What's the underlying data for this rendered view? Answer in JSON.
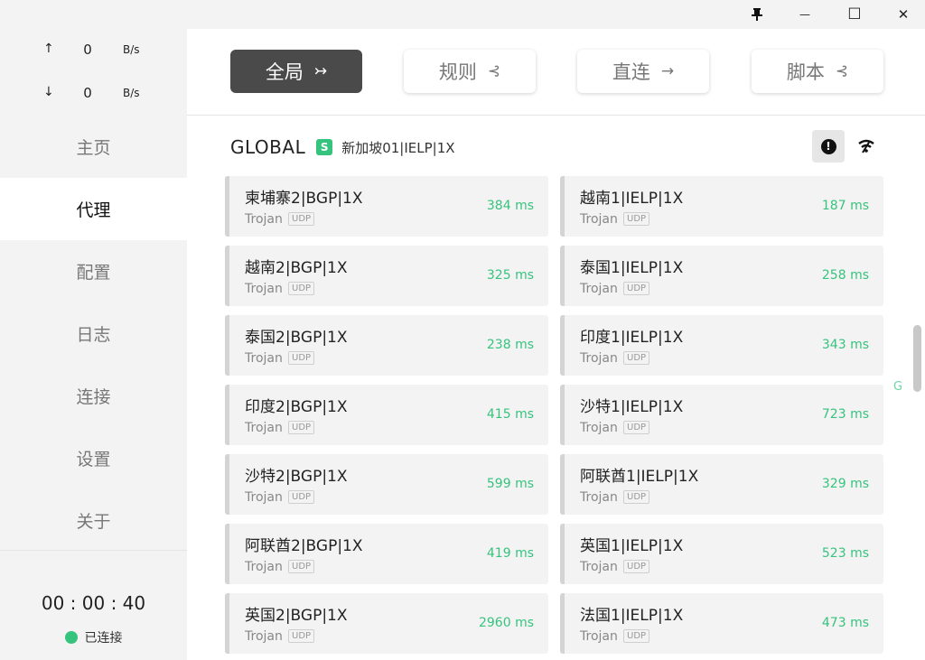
{
  "titlebar": {
    "pin_icon": "pin-icon",
    "minimize_glyph": "—",
    "maximize_glyph": "☐",
    "close_glyph": "✕"
  },
  "traffic": {
    "up_arrow": "↑",
    "up_value": "0",
    "up_unit": "B/s",
    "down_arrow": "↓",
    "down_value": "0",
    "down_unit": "B/s"
  },
  "nav": {
    "home": "主页",
    "proxy": "代理",
    "profiles": "配置",
    "logs": "日志",
    "connections": "连接",
    "settings": "设置",
    "about": "关于"
  },
  "footer": {
    "timer": "00 : 00 : 40",
    "status": "已连接",
    "status_color": "#36c37d"
  },
  "modes": {
    "global": {
      "label": "全局",
      "icon": "↣"
    },
    "rule": {
      "label": "规则",
      "icon": "⊰"
    },
    "direct": {
      "label": "直连",
      "icon": "→"
    },
    "script": {
      "label": "脚本",
      "icon": "⊰"
    }
  },
  "group": {
    "name": "GLOBAL",
    "badge": "S",
    "selected": "新加坡01|IELP|1X"
  },
  "proxies": {
    "left": [
      {
        "name": "柬埔寨2|BGP|1X",
        "type": "Trojan",
        "tag": "UDP",
        "delay": "384 ms"
      },
      {
        "name": "越南2|BGP|1X",
        "type": "Trojan",
        "tag": "UDP",
        "delay": "325 ms"
      },
      {
        "name": "泰国2|BGP|1X",
        "type": "Trojan",
        "tag": "UDP",
        "delay": "238 ms"
      },
      {
        "name": "印度2|BGP|1X",
        "type": "Trojan",
        "tag": "UDP",
        "delay": "415 ms"
      },
      {
        "name": "沙特2|BGP|1X",
        "type": "Trojan",
        "tag": "UDP",
        "delay": "599 ms"
      },
      {
        "name": "阿联酋2|BGP|1X",
        "type": "Trojan",
        "tag": "UDP",
        "delay": "419 ms"
      },
      {
        "name": "英国2|BGP|1X",
        "type": "Trojan",
        "tag": "UDP",
        "delay": "2960 ms"
      }
    ],
    "right": [
      {
        "name": "越南1|IELP|1X",
        "type": "Trojan",
        "tag": "UDP",
        "delay": "187 ms"
      },
      {
        "name": "泰国1|IELP|1X",
        "type": "Trojan",
        "tag": "UDP",
        "delay": "258 ms"
      },
      {
        "name": "印度1|IELP|1X",
        "type": "Trojan",
        "tag": "UDP",
        "delay": "343 ms"
      },
      {
        "name": "沙特1|IELP|1X",
        "type": "Trojan",
        "tag": "UDP",
        "delay": "723 ms"
      },
      {
        "name": "阿联酋1|IELP|1X",
        "type": "Trojan",
        "tag": "UDP",
        "delay": "329 ms"
      },
      {
        "name": "英国1|IELP|1X",
        "type": "Trojan",
        "tag": "UDP",
        "delay": "523 ms"
      },
      {
        "name": "法国1|IELP|1X",
        "type": "Trojan",
        "tag": "UDP",
        "delay": "473 ms"
      }
    ]
  },
  "scroll_letter": "G",
  "colors": {
    "accent_green": "#36c37d",
    "active_mode_bg": "#4a4a4a",
    "sidebar_bg": "#f3f3f3"
  }
}
